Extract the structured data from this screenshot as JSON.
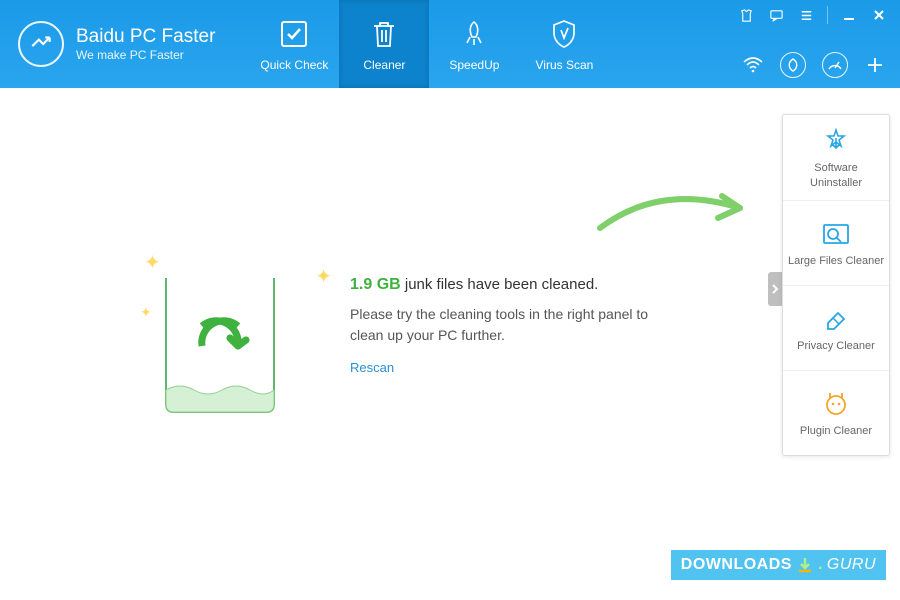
{
  "app": {
    "title": "Baidu PC Faster",
    "tagline": "We make PC Faster"
  },
  "nav": {
    "items": [
      {
        "label": "Quick Check"
      },
      {
        "label": "Cleaner"
      },
      {
        "label": "SpeedUp"
      },
      {
        "label": "Virus Scan"
      }
    ]
  },
  "result": {
    "size": "1.9 GB",
    "headline_suffix": "junk files have been cleaned.",
    "hint": "Please try the cleaning tools in the right panel to clean up your PC further.",
    "rescan_label": "Rescan"
  },
  "right_panel": {
    "items": [
      {
        "label": "Software Uninstaller"
      },
      {
        "label": "Large Files Cleaner"
      },
      {
        "label": "Privacy Cleaner"
      },
      {
        "label": "Plugin Cleaner"
      }
    ]
  },
  "watermark": {
    "left": "DOWNLOADS",
    "right": "GURU"
  },
  "colors": {
    "header": "#1b9ae8",
    "accent_green": "#3fb13f",
    "link": "#2a8fd6",
    "rp_blue": "#27a6e6",
    "rp_orange": "#f5a623"
  }
}
